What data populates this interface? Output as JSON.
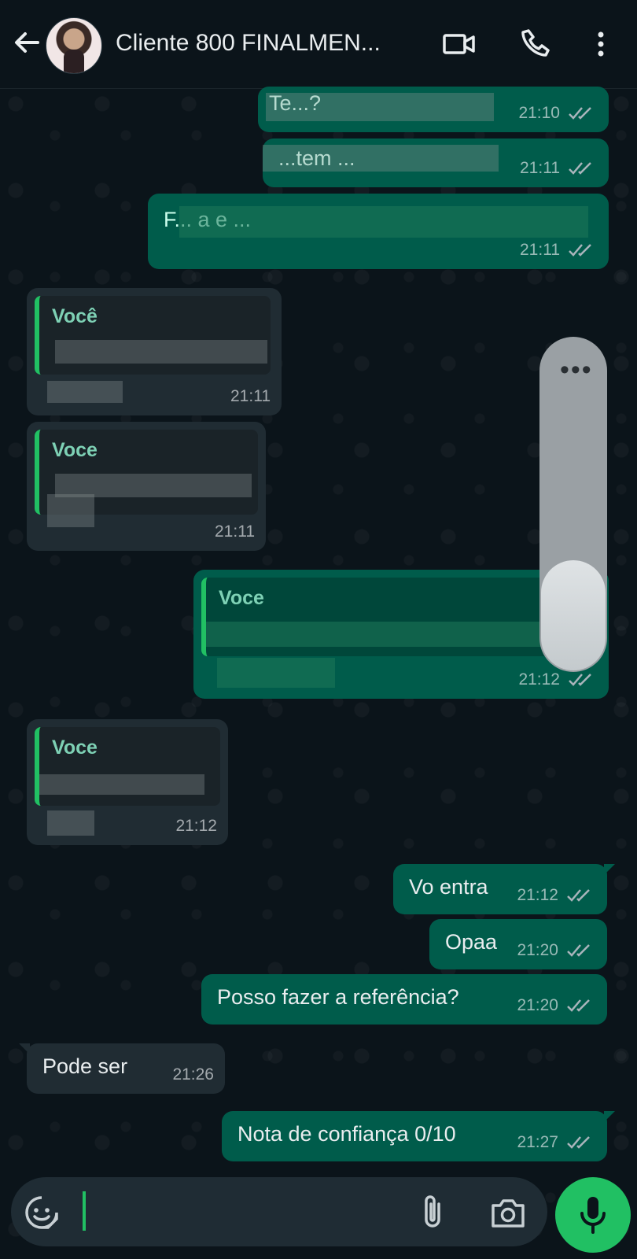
{
  "header": {
    "title": "Cliente 800 FINALMEN..."
  },
  "messages": {
    "m1": {
      "text": "Te...?",
      "time": "21:10"
    },
    "m2": {
      "text": "...tem ...",
      "time": "21:11"
    },
    "m3": {
      "text": "F... a e ... ",
      "time": "21:11"
    },
    "m4": {
      "quote_author": "Você",
      "time": "21:11"
    },
    "m5": {
      "quote_author": "Voce",
      "time": "21:11"
    },
    "m6": {
      "quote_author": "Voce",
      "time": "21:12"
    },
    "m7": {
      "quote_author": "Voce",
      "time": "21:12"
    },
    "m8": {
      "text": "Vo entra",
      "time": "21:12"
    },
    "m9": {
      "text": "Opaa",
      "time": "21:20"
    },
    "m10": {
      "text": "Posso fazer a referência?",
      "time": "21:20"
    },
    "m11": {
      "text": "Pode ser",
      "time": "21:26"
    },
    "m12": {
      "text": "Nota de confiança 0/10",
      "time": "21:27"
    }
  },
  "colors": {
    "outgoing": "#005c4b",
    "incoming": "#202c33",
    "accent": "#21c063",
    "background": "#0b141a"
  },
  "icons": {
    "back": "arrow-left-icon",
    "video": "video-camera-icon",
    "call": "phone-icon",
    "menu": "more-vertical-icon",
    "emoji": "sticker-icon",
    "attach": "paperclip-icon",
    "camera": "camera-icon",
    "mic": "microphone-icon"
  }
}
